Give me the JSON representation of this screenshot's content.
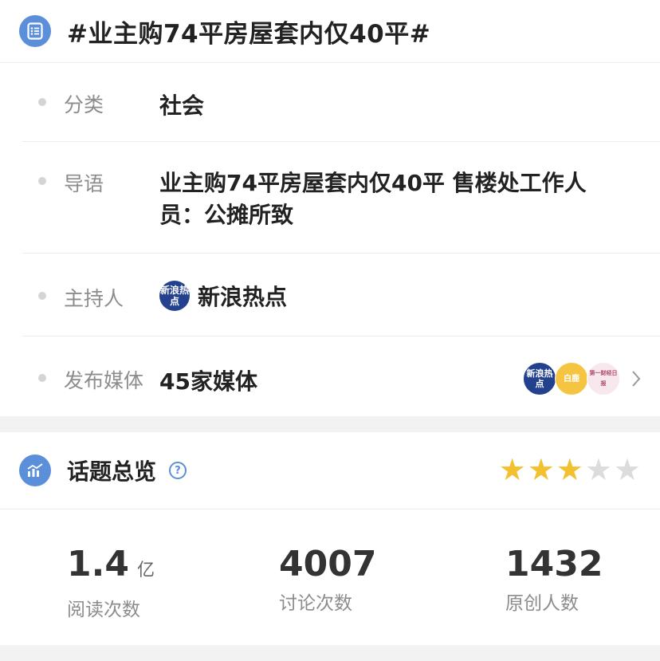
{
  "topic": {
    "title": "#业主购74平房屋套内仅40平#"
  },
  "info": {
    "category": {
      "label": "分类",
      "value": "社会"
    },
    "intro": {
      "label": "导语",
      "value": "业主购74平房屋套内仅40平 售楼处工作人员：公摊所致"
    },
    "host": {
      "label": "主持人",
      "value": "新浪热点",
      "avatar_text": "新浪热点"
    },
    "media": {
      "label": "发布媒体",
      "value": "45家媒体",
      "avatars": [
        "新浪热点",
        "白鹿",
        "第一财经日报"
      ]
    }
  },
  "overview": {
    "title": "话题总览",
    "help_icon": "question-circle-icon",
    "rating": 3,
    "rating_max": 5,
    "star_color": "#f3c130",
    "stats": [
      {
        "value": "1.4",
        "unit": "亿",
        "caption": "阅读次数"
      },
      {
        "value": "4007",
        "unit": "",
        "caption": "讨论次数"
      },
      {
        "value": "1432",
        "unit": "",
        "caption": "原创人数"
      }
    ]
  },
  "colors": {
    "accent": "#5b8fd9"
  }
}
